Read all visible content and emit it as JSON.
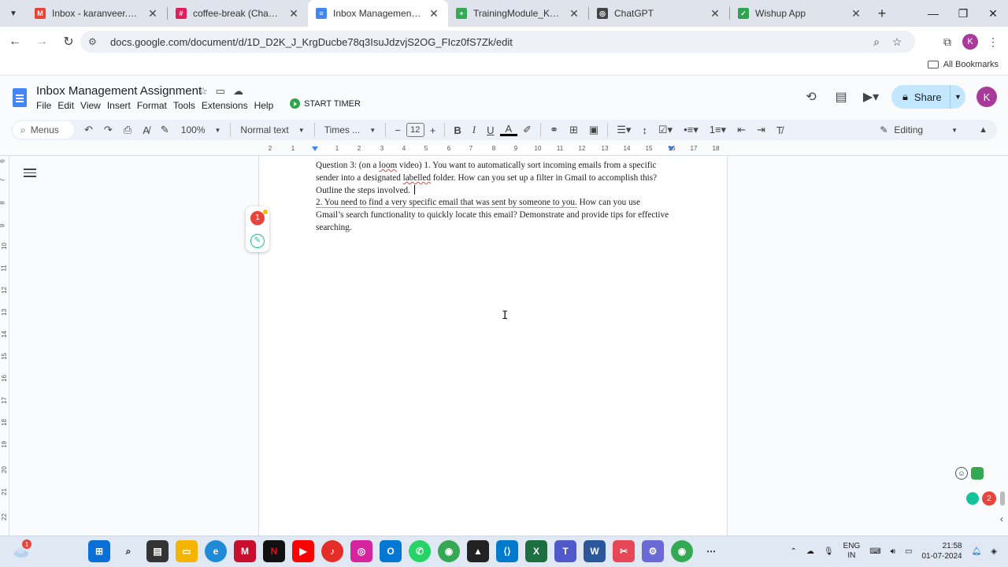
{
  "browser": {
    "tabs": [
      {
        "title": "Inbox - karanveer.singh@w",
        "icon": "gmail-icon",
        "color": "#ea4335",
        "active": false
      },
      {
        "title": "coffee-break (Channel) - W",
        "icon": "slack-icon",
        "color": "#e01e5a",
        "active": false
      },
      {
        "title": "Inbox Management Assign",
        "icon": "docs-icon",
        "color": "#4285f4",
        "active": true
      },
      {
        "title": "TrainingModule_Karanveer",
        "icon": "sheets-icon",
        "color": "#34a853",
        "active": false
      },
      {
        "title": "ChatGPT",
        "icon": "chatgpt-icon",
        "color": "#444444",
        "active": false
      },
      {
        "title": "Wishup App",
        "icon": "wishup-icon",
        "color": "#2ea44f",
        "active": false
      }
    ],
    "url": "docs.google.com/document/d/1D_D2K_J_KrgDucbe78q3IsuJdzvjS2OG_FIcz0fS7Zk/edit",
    "bookmarks_label": "All Bookmarks",
    "profile_initial": "K"
  },
  "docs": {
    "title": "Inbox Management Assignment",
    "menu": [
      "File",
      "Edit",
      "View",
      "Insert",
      "Format",
      "Tools",
      "Extensions",
      "Help"
    ],
    "timer_label": "START TIMER",
    "share_label": "Share",
    "avatar_initial": "K",
    "toolbar": {
      "menus_label": "Menus",
      "zoom": "100%",
      "style": "Normal text",
      "font": "Times ...",
      "font_size": "12",
      "mode": "Editing"
    },
    "ruler_labels": [
      "2",
      "1",
      "1",
      "2",
      "3",
      "4",
      "5",
      "6",
      "7",
      "8",
      "9",
      "10",
      "11",
      "12",
      "13",
      "14",
      "15",
      "16",
      "17",
      "18"
    ],
    "vruler_labels": [
      "6",
      "7",
      "8",
      "9",
      "10",
      "11",
      "12",
      "13",
      "14",
      "15",
      "16",
      "17",
      "18",
      "19",
      "20",
      "21",
      "22"
    ],
    "body": {
      "q3_a": "Question 3: (on a ",
      "q3_loom": "loom",
      "q3_b": " video) 1. You want to automatically sort incoming emails from a specific sender into a designated ",
      "q3_labelled": "labelled",
      "q3_c": " folder. How can you set up a filter in Gmail to accomplish this? Outline the steps involved. ",
      "q2_a": "2. You need to find a very specific email that was sent by someone to you.",
      "q2_b": " How can you use Gmail’s search functionality to quickly locate this email? Demonstrate and provide tips for effective searching."
    },
    "side_badge_count": "1",
    "floating_badge_count": "2"
  },
  "taskbar": {
    "weather_badge": "1",
    "lang_line1": "ENG",
    "lang_line2": "IN",
    "time": "21:58",
    "date": "01-07-2024"
  }
}
